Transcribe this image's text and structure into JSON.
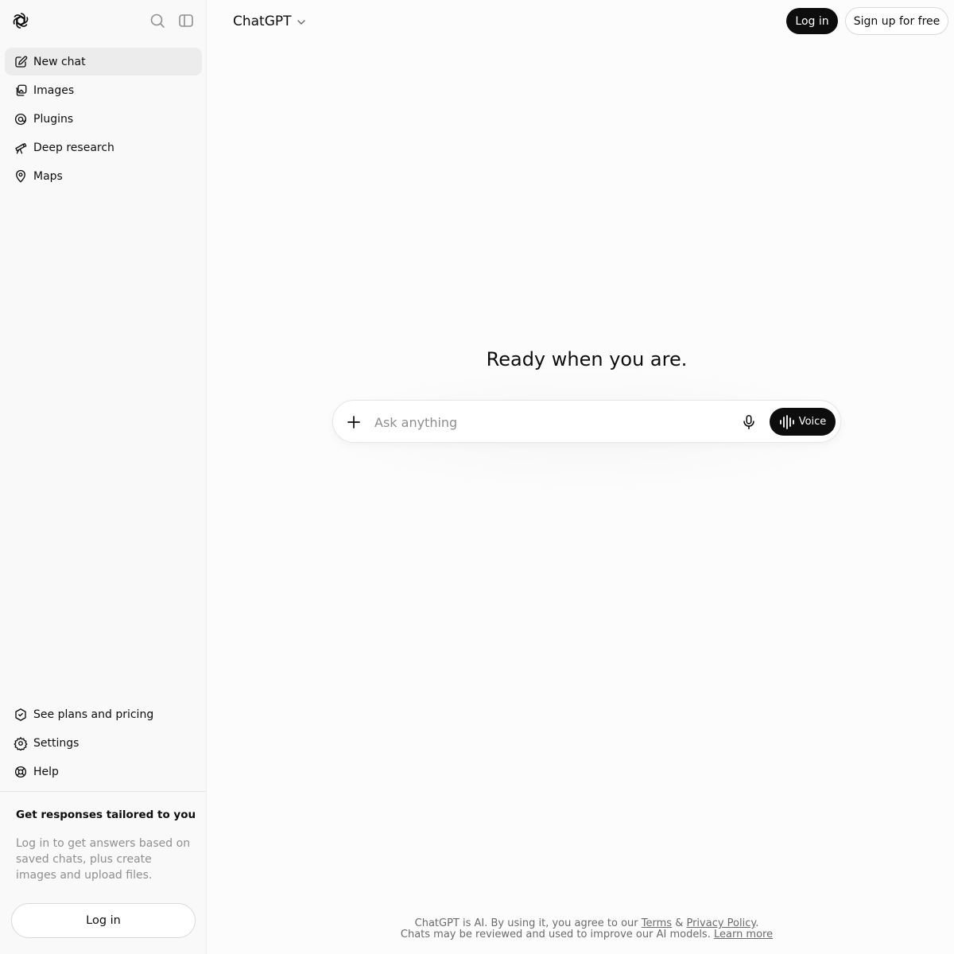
{
  "sidebar": {
    "nav": [
      {
        "label": "New chat",
        "icon": "edit-icon"
      },
      {
        "label": "Images",
        "icon": "images-icon"
      },
      {
        "label": "Plugins",
        "icon": "plugins-icon"
      },
      {
        "label": "Deep research",
        "icon": "telescope-icon"
      },
      {
        "label": "Maps",
        "icon": "map-pin-icon"
      }
    ],
    "bottom": [
      {
        "label": "See plans and pricing",
        "icon": "badge-icon"
      },
      {
        "label": "Settings",
        "icon": "gear-icon"
      },
      {
        "label": "Help",
        "icon": "lifebuoy-icon"
      }
    ],
    "promo": {
      "title": "Get responses tailored to you",
      "text": "Log in to get answers based on saved chats, plus create images and upload files.",
      "login_label": "Log in"
    }
  },
  "header": {
    "model_name": "ChatGPT",
    "login_label": "Log in",
    "signup_label": "Sign up for free"
  },
  "main": {
    "hero_title": "Ready when you are.",
    "composer": {
      "placeholder": "Ask anything",
      "voice_label": "Voice"
    }
  },
  "footer": {
    "line1_prefix": "ChatGPT is AI. By using it, you agree to our ",
    "terms": "Terms",
    "amp": " & ",
    "privacy": "Privacy Policy",
    "line1_suffix": ".",
    "line2_prefix": "Chats may be reviewed and used to improve our AI models. ",
    "learn_more": "Learn more"
  },
  "colors": {
    "accent": "#0d0d0d",
    "sidebar_bg": "#f9f9f9",
    "main_bg": "#fcfcfc",
    "muted_text": "#8f8f8f"
  }
}
